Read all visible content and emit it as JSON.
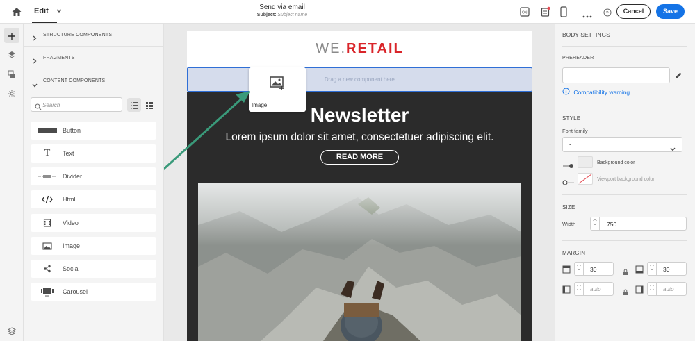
{
  "topbar": {
    "mode_label": "Edit",
    "title": "Send via email",
    "subject_label": "Subject:",
    "subject_placeholder": "Subject name",
    "cancel_label": "Cancel",
    "save_label": "Save",
    "accent_color": "#1473e6"
  },
  "leftpanel": {
    "sections": [
      {
        "label": "STRUCTURE COMPONENTS"
      },
      {
        "label": "FRAGMENTS"
      },
      {
        "label": "CONTENT COMPONENTS"
      }
    ],
    "search_placeholder": "Search",
    "components": [
      {
        "label": "Button",
        "icon": "button-icon"
      },
      {
        "label": "Text",
        "icon": "text-icon"
      },
      {
        "label": "Divider",
        "icon": "divider-icon"
      },
      {
        "label": "Html",
        "icon": "html-icon"
      },
      {
        "label": "Video",
        "icon": "video-icon"
      },
      {
        "label": "Image",
        "icon": "image-icon"
      },
      {
        "label": "Social",
        "icon": "share-icon"
      },
      {
        "label": "Carousel",
        "icon": "carousel-icon"
      }
    ]
  },
  "canvas": {
    "logo_part1": "WE.",
    "logo_part2": "RETAIL",
    "logo_color2": "#d9252a",
    "dropzone_text": "Drag a new component here.",
    "drag_ghost_label": "Image",
    "headline": "Newsletter",
    "body": "Lorem ipsum dolor sit amet, consectetuer adipiscing elit.",
    "cta_label": "READ MORE",
    "arrow_color": "#3a9a7a"
  },
  "rightpanel": {
    "title": "BODY SETTINGS",
    "preheader_label": "PREHEADER",
    "compat_warning": "Compatibility warning.",
    "style_label": "STYLE",
    "font_family_label": "Font family",
    "font_family_value": "-",
    "bg_color_label": "Background color",
    "viewport_bg_label": "Viewport background color",
    "size_label": "SIZE",
    "width_label": "Width",
    "width_value": "750",
    "margin_label": "MARGIN",
    "margin_top": "30",
    "margin_bottom": "30",
    "margin_left_placeholder": "auto",
    "margin_right_placeholder": "auto"
  }
}
